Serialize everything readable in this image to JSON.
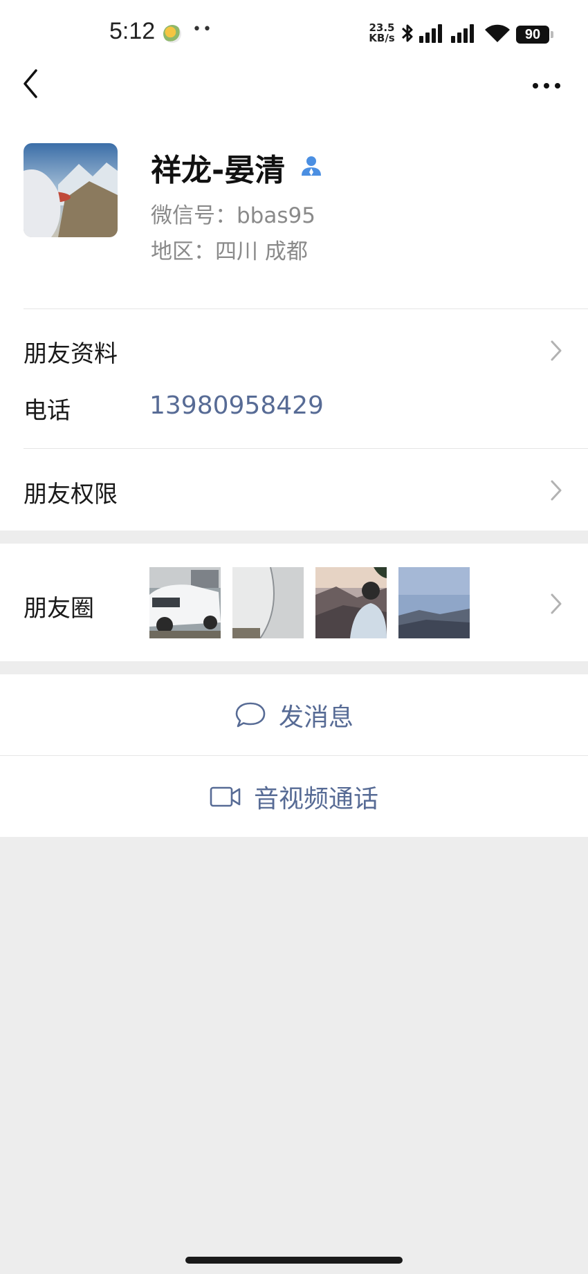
{
  "status_bar": {
    "time": "5:12",
    "net_speed_value": "23.5",
    "net_speed_unit": "KB/s",
    "battery": "90"
  },
  "profile": {
    "name": "祥龙-晏清",
    "wechat_id": "微信号：bbas95",
    "region": "地区：四川  成都"
  },
  "rows": {
    "friend_info": "朋友资料",
    "phone_label": "电话",
    "phone_number": "13980958429",
    "friend_permissions": "朋友权限",
    "moments": "朋友圈"
  },
  "actions": {
    "message": "发消息",
    "video_call": "音视频通话"
  },
  "icons": {
    "back": "chevron-left-icon",
    "more": "more-dots-icon",
    "contact_badge": "person-icon",
    "message": "chat-bubble-icon",
    "video": "video-camera-icon"
  },
  "colors": {
    "link": "#576b95",
    "badge": "#4b8fe2",
    "background": "#ededed"
  }
}
